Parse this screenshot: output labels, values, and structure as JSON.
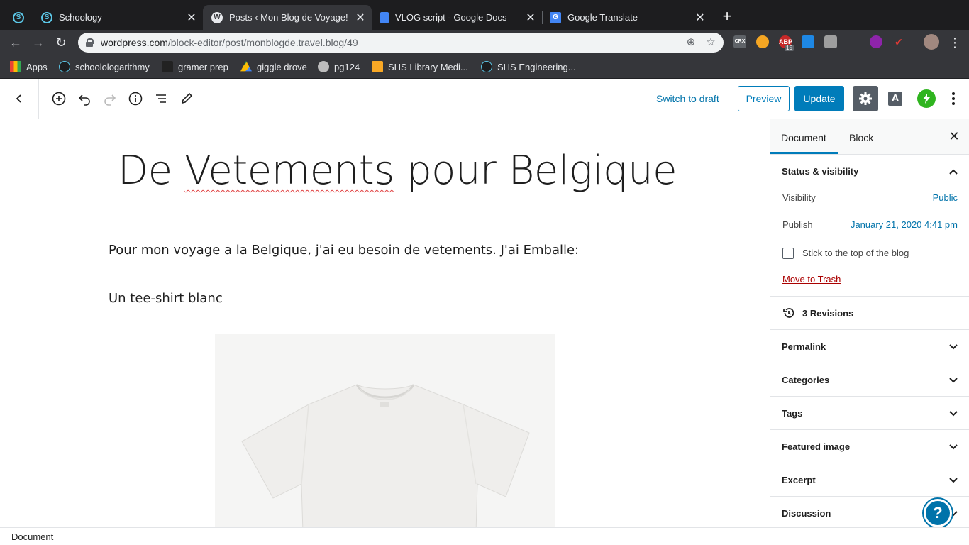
{
  "browser": {
    "tabs": [
      {
        "title": "Schoology",
        "icon": "schoology-icon"
      },
      {
        "title": "Posts ‹ Mon Blog de Voyage! —",
        "icon": "wordpress-icon"
      },
      {
        "title": "VLOG script - Google Docs",
        "icon": "google-docs-icon"
      },
      {
        "title": "Google Translate",
        "icon": "google-translate-icon"
      }
    ],
    "url_main": "wordpress.com",
    "url_path": "/block-editor/post/monblogde.travel.blog/49",
    "bookmarks": [
      {
        "label": "Apps"
      },
      {
        "label": "schoolologarithmy"
      },
      {
        "label": "gramer prep"
      },
      {
        "label": "giggle drove"
      },
      {
        "label": "pg124"
      },
      {
        "label": "SHS Library Medi..."
      },
      {
        "label": "SHS Engineering..."
      }
    ],
    "extension_badge": "15"
  },
  "editor": {
    "switch_to_draft": "Switch to draft",
    "preview": "Preview",
    "update": "Update",
    "a_button": "A"
  },
  "post": {
    "title_pre": "De ",
    "title_word": "Vetements",
    "title_post": " pour Belgique",
    "para1": "Pour mon voyage a la Belgique, j'ai eu besoin de vetements. J'ai Emballe:",
    "para2": "Un tee-shirt blanc"
  },
  "sidebar": {
    "tab_document": "Document",
    "tab_block": "Block",
    "close": "✕",
    "status_visibility": "Status & visibility",
    "visibility_label": "Visibility",
    "visibility_value": "Public",
    "publish_label": "Publish",
    "publish_value": "January 21, 2020 4:41 pm",
    "stick_label": "Stick to the top of the blog",
    "move_to_trash": "Move to Trash",
    "revisions": "3 Revisions",
    "sections": [
      "Permalink",
      "Categories",
      "Tags",
      "Featured image",
      "Excerpt",
      "Discussion"
    ]
  },
  "footer": {
    "breadcrumb": "Document"
  },
  "help": "?"
}
